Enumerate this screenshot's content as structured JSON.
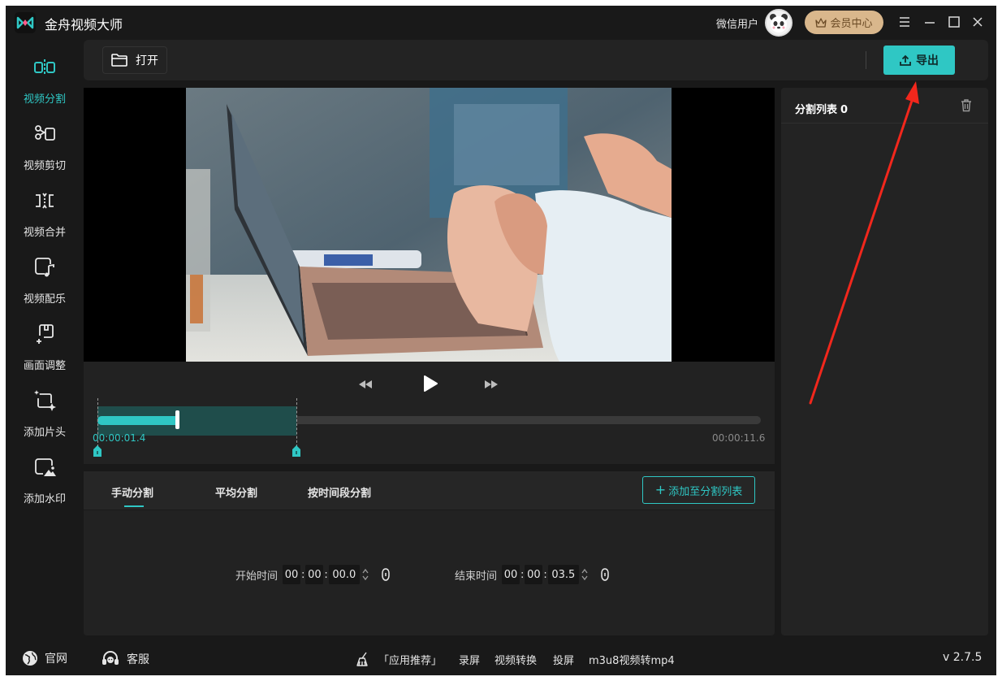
{
  "app": {
    "title": "金舟视频大师",
    "user_name": "微信用户",
    "vip_label": "会员中心",
    "accent_color": "#2fc7c4"
  },
  "window_controls": [
    "menu-icon",
    "minimize-icon",
    "maximize-icon",
    "close-icon"
  ],
  "sidebar": {
    "items": [
      {
        "label": "视频分割",
        "icon": "split-icon",
        "active": true
      },
      {
        "label": "视频剪切",
        "icon": "scissors-icon",
        "active": false
      },
      {
        "label": "视频合并",
        "icon": "merge-icon",
        "active": false
      },
      {
        "label": "视频配乐",
        "icon": "music-icon",
        "active": false
      },
      {
        "label": "画面调整",
        "icon": "crop-icon",
        "active": false
      },
      {
        "label": "添加片头",
        "icon": "sparkle-icon",
        "active": false
      },
      {
        "label": "添加水印",
        "icon": "watermark-icon",
        "active": false
      }
    ]
  },
  "toolbar": {
    "open_label": "打开",
    "export_label": "导出"
  },
  "player": {
    "current_time": "00:00:01.4",
    "total_time": "00:00:11.6",
    "progress_fraction": 0.12,
    "selection_end_fraction": 0.3
  },
  "split": {
    "tabs": [
      {
        "label": "手动分割",
        "active": true
      },
      {
        "label": "平均分割",
        "active": false
      },
      {
        "label": "按时间段分割",
        "active": false
      }
    ],
    "add_to_list_label": "添加至分割列表",
    "start": {
      "label": "开始时间",
      "hh": "00",
      "mm": "00",
      "ss": "00.0"
    },
    "end": {
      "label": "结束时间",
      "hh": "00",
      "mm": "00",
      "ss": "03.5"
    }
  },
  "split_list": {
    "title": "分割列表",
    "count": "0"
  },
  "footer": {
    "website_label": "官网",
    "support_label": "客服",
    "recommend_label": "「应用推荐」",
    "links": [
      "录屏",
      "视频转换",
      "投屏",
      "m3u8视频转mp4"
    ],
    "version": "v 2.7.5"
  }
}
